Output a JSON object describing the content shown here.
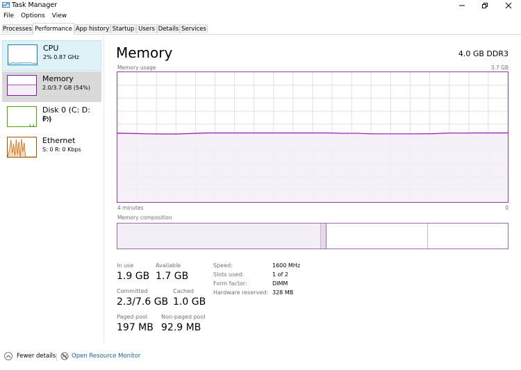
{
  "window": {
    "title": "Task Manager",
    "icons": {
      "app": "task-manager-icon",
      "minimize": "minimize-icon",
      "restore": "restore-icon",
      "close": "close-icon"
    }
  },
  "menu": [
    "File",
    "Options",
    "View"
  ],
  "tabs": [
    {
      "label": "Processes",
      "active": false
    },
    {
      "label": "Performance",
      "active": true
    },
    {
      "label": "App history",
      "active": false
    },
    {
      "label": "Startup",
      "active": false
    },
    {
      "label": "Users",
      "active": false
    },
    {
      "label": "Details",
      "active": false
    },
    {
      "label": "Services",
      "active": false
    }
  ],
  "sidebar": {
    "items": [
      {
        "name": "CPU",
        "sub": "2% 0.87 GHz",
        "color": "#117dbb",
        "selected": false
      },
      {
        "name": "Memory",
        "sub": "2.0/3.7 GB (54%)",
        "color": "#8b12ae",
        "selected": true
      },
      {
        "name": "Disk 0 (C: D: F:)",
        "sub": "0%",
        "color": "#4da60c",
        "selected": false
      },
      {
        "name": "Ethernet",
        "sub": "S: 0 R: 0 Kbps",
        "color": "#a74f01",
        "selected": false
      }
    ]
  },
  "main": {
    "title": "Memory",
    "hardware": "4.0 GB DDR3",
    "usage_label": "Memory usage",
    "usage_max": "3.7 GB",
    "time_left": "4 minutes",
    "time_right": "0",
    "composition_label": "Memory composition",
    "accent": "#8b12ae",
    "fill": "#f4eef7"
  },
  "chart_data": {
    "type": "area",
    "title": "Memory usage",
    "xlabel": "",
    "ylabel": "",
    "x_range_label": [
      "4 minutes",
      "0"
    ],
    "ylim": [
      0,
      3.7
    ],
    "y_unit": "GB",
    "grid": true,
    "series": [
      {
        "name": "Memory in use (fraction of max)",
        "values": [
          0.53,
          0.528,
          0.525,
          0.524,
          0.524,
          0.528,
          0.532,
          0.532,
          0.532,
          0.532,
          0.532,
          0.532,
          0.532,
          0.532,
          0.532,
          0.529,
          0.529,
          0.525,
          0.525,
          0.525,
          0.525,
          0.526,
          0.531,
          0.531,
          0.532,
          0.532,
          0.532
        ]
      }
    ]
  },
  "composition": {
    "in_use_fraction": 0.52,
    "modified_fraction": 0.016,
    "standby_fraction": 0.26,
    "free_fraction": 0.204
  },
  "stats": {
    "in_use": {
      "label": "In use",
      "value": "1.9 GB"
    },
    "available": {
      "label": "Available",
      "value": "1.7 GB"
    },
    "committed": {
      "label": "Committed",
      "value": "2.3/7.6 GB"
    },
    "cached": {
      "label": "Cached",
      "value": "1.0 GB"
    },
    "paged_pool": {
      "label": "Paged pool",
      "value": "197 MB"
    },
    "non_paged_pool": {
      "label": "Non-paged pool",
      "value": "92.9 MB"
    }
  },
  "specs": [
    {
      "label": "Speed:",
      "value": "1600 MHz"
    },
    {
      "label": "Slots used:",
      "value": "1 of 2"
    },
    {
      "label": "Form factor:",
      "value": "DIMM"
    },
    {
      "label": "Hardware reserved:",
      "value": "328 MB"
    }
  ],
  "footer": {
    "fewer_details": "Fewer details",
    "resource_monitor": "Open Resource Monitor"
  }
}
